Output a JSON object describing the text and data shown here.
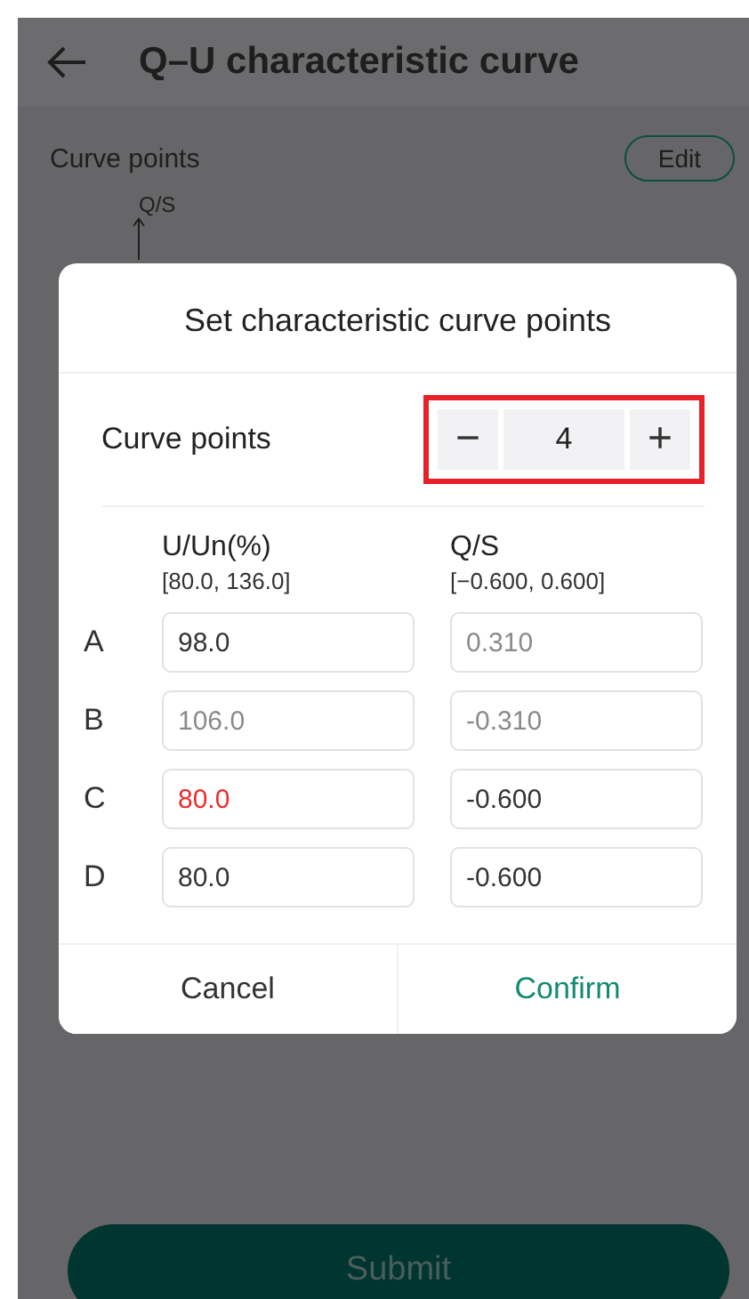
{
  "header": {
    "title": "Q–U characteristic curve"
  },
  "section": {
    "label": "Curve points",
    "edit_button": "Edit"
  },
  "chart": {
    "y_axis_label": "Q/S"
  },
  "dialog": {
    "title": "Set characteristic curve points",
    "stepper": {
      "label": "Curve points",
      "value": "4",
      "decrement": "−",
      "increment": "+",
      "highlighted": true
    },
    "columns": [
      {
        "name": "U/Un(%)",
        "range": "[80.0, 136.0]"
      },
      {
        "name": "Q/S",
        "range": "[−0.600, 0.600]"
      }
    ],
    "rows": [
      {
        "label": "A",
        "cells": [
          {
            "value": "98.0",
            "invalid": false
          },
          {
            "placeholder": "0.310"
          }
        ]
      },
      {
        "label": "B",
        "cells": [
          {
            "placeholder": "106.0"
          },
          {
            "placeholder": "-0.310"
          }
        ]
      },
      {
        "label": "C",
        "cells": [
          {
            "value": "80.0",
            "invalid": true
          },
          {
            "value": "-0.600",
            "invalid": false
          }
        ]
      },
      {
        "label": "D",
        "cells": [
          {
            "value": "80.0",
            "invalid": false
          },
          {
            "value": "-0.600",
            "invalid": false
          }
        ]
      }
    ],
    "cancel": "Cancel",
    "confirm": "Confirm"
  },
  "submit": {
    "label": "Submit"
  }
}
